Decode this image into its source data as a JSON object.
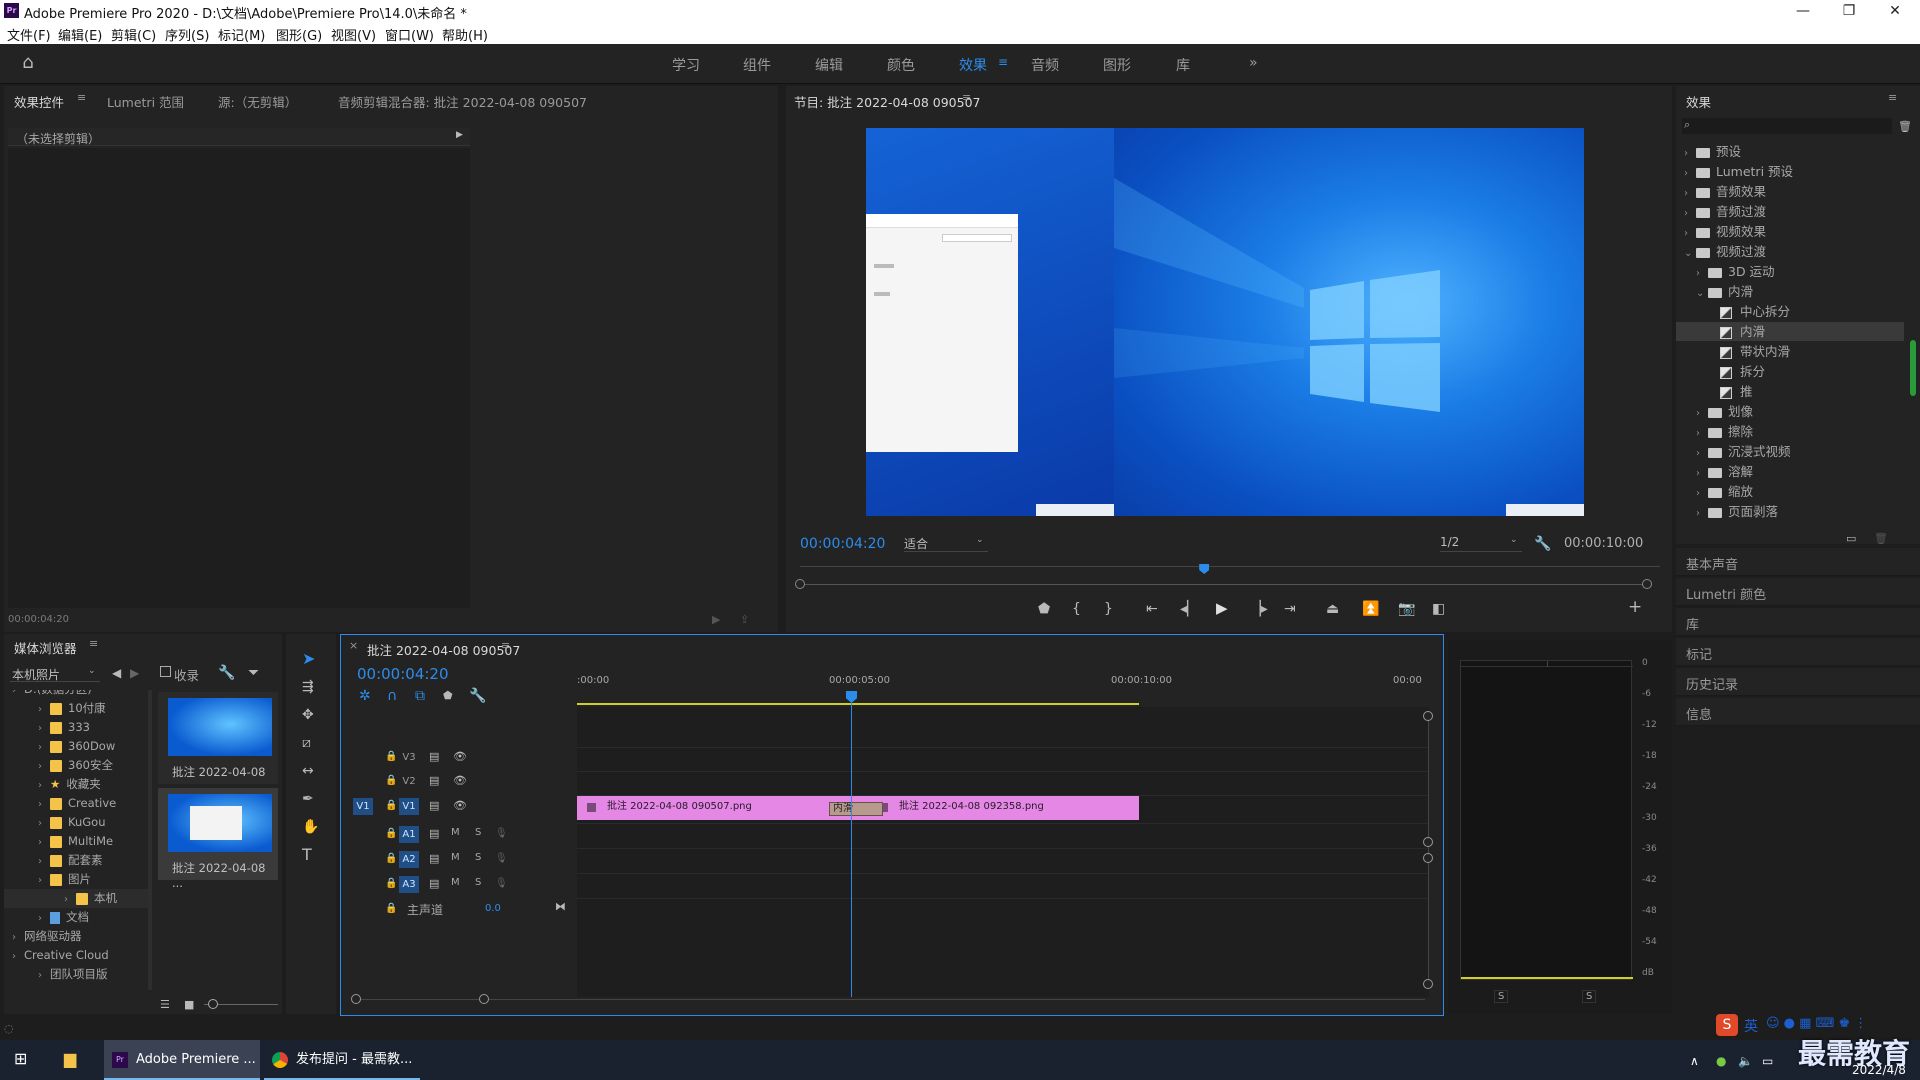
{
  "titlebar": {
    "title": "Adobe Premiere Pro 2020 - D:\\文档\\Adobe\\Premiere Pro\\14.0\\未命名 *",
    "app_icon": "Pr",
    "minimize": "—",
    "maximize": "❐",
    "close": "✕"
  },
  "menu": [
    "文件(F)",
    "编辑(E)",
    "剪辑(C)",
    "序列(S)",
    "标记(M)",
    "图形(G)",
    "视图(V)",
    "窗口(W)",
    "帮助(H)"
  ],
  "workspaces": {
    "items": [
      "学习",
      "组件",
      "编辑",
      "颜色",
      "效果",
      "音频",
      "图形",
      "库"
    ],
    "active": "效果",
    "more": "»"
  },
  "source_panel": {
    "tabs": [
      "效果控件",
      "Lumetri 范围",
      "源:（无剪辑）",
      "音频剪辑混合器: 批注 2022-04-08 090507"
    ],
    "no_clip": "（未选择剪辑）",
    "timecode": "00:00:04:20"
  },
  "program_monitor": {
    "title": "节目: 批注 2022-04-08 090507",
    "timecode": "00:00:04:20",
    "fit": "适合",
    "resolution": "1/2",
    "duration": "00:00:10:00",
    "playhead_fraction": 0.47
  },
  "effects_panel": {
    "title": "效果",
    "items": [
      {
        "label": "预设",
        "level": 0,
        "type": "folder",
        "open": false
      },
      {
        "label": "Lumetri 预设",
        "level": 0,
        "type": "folder",
        "open": false
      },
      {
        "label": "音频效果",
        "level": 0,
        "type": "folder",
        "open": false
      },
      {
        "label": "音频过渡",
        "level": 0,
        "type": "folder",
        "open": false
      },
      {
        "label": "视频效果",
        "level": 0,
        "type": "folder",
        "open": false
      },
      {
        "label": "视频过渡",
        "level": 0,
        "type": "folder",
        "open": true
      },
      {
        "label": "3D 运动",
        "level": 1,
        "type": "folder",
        "open": false
      },
      {
        "label": "内滑",
        "level": 1,
        "type": "folder",
        "open": true
      },
      {
        "label": "中心拆分",
        "level": 2,
        "type": "fx"
      },
      {
        "label": "内滑",
        "level": 2,
        "type": "fx",
        "selected": true
      },
      {
        "label": "带状内滑",
        "level": 2,
        "type": "fx"
      },
      {
        "label": "拆分",
        "level": 2,
        "type": "fx"
      },
      {
        "label": "推",
        "level": 2,
        "type": "fx"
      },
      {
        "label": "划像",
        "level": 1,
        "type": "folder",
        "open": false
      },
      {
        "label": "擦除",
        "level": 1,
        "type": "folder",
        "open": false
      },
      {
        "label": "沉浸式视频",
        "level": 1,
        "type": "folder",
        "open": false
      },
      {
        "label": "溶解",
        "level": 1,
        "type": "folder",
        "open": false
      },
      {
        "label": "缩放",
        "level": 1,
        "type": "folder",
        "open": false
      },
      {
        "label": "页面剥落",
        "level": 1,
        "type": "folder",
        "open": false
      }
    ],
    "sections": [
      "基本声音",
      "Lumetri 颜色",
      "库",
      "标记",
      "历史记录",
      "信息"
    ]
  },
  "media_browser": {
    "title": "媒体浏览器",
    "location": "本机照片",
    "ingest": "收录",
    "tree": [
      {
        "label": "D:(数据分区)",
        "level": 0
      },
      {
        "label": "10付康",
        "level": 1,
        "type": "folder"
      },
      {
        "label": "333",
        "level": 1,
        "type": "folder"
      },
      {
        "label": "360Dow",
        "level": 1,
        "type": "folder"
      },
      {
        "label": "360安全",
        "level": 1,
        "type": "folder"
      },
      {
        "label": "收藏夹",
        "level": 1,
        "type": "star"
      },
      {
        "label": "Creative",
        "level": 1,
        "type": "folder"
      },
      {
        "label": "KuGou",
        "level": 1,
        "type": "folder"
      },
      {
        "label": "MultiMe",
        "level": 1,
        "type": "folder"
      },
      {
        "label": "配套素",
        "level": 1,
        "type": "folder"
      },
      {
        "label": "图片",
        "level": 1,
        "type": "folder"
      },
      {
        "label": "本机",
        "level": 2,
        "type": "folder"
      },
      {
        "label": "文档",
        "level": 1,
        "type": "doc"
      },
      {
        "label": "网络驱动器",
        "level": 0
      },
      {
        "label": "Creative Cloud",
        "level": 0
      },
      {
        "label": "团队项目版",
        "level": 1
      }
    ],
    "thumbs": [
      "批注 2022-04-08 ...",
      "批注 2022-04-08 ..."
    ]
  },
  "timeline": {
    "title": "批注 2022-04-08 090507",
    "timecode": "00:00:04:20",
    "ruler": [
      ":00:00",
      "00:00:05:00",
      "00:00:10:00",
      "00:00"
    ],
    "video_tracks": [
      "V3",
      "V2",
      "V1"
    ],
    "audio_tracks": [
      "A1",
      "A2",
      "A3"
    ],
    "master": "主声道",
    "master_value": "0.0",
    "source_patch": "V1",
    "clips": [
      "批注 2022-04-08 090507.png",
      "批注 2022-04-08 092358.png"
    ],
    "transition": "内滑",
    "m": "M",
    "s": "S"
  },
  "audio_meter": {
    "scale": [
      "0",
      "-6",
      "-12",
      "-18",
      "-24",
      "-30",
      "-36",
      "-42",
      "-48",
      "-54",
      "dB"
    ],
    "solo": [
      "S",
      "S"
    ]
  },
  "taskbar": {
    "apps": [
      "Adobe Premiere ...",
      "发布提问 - 最需教..."
    ],
    "date": "2022/4/8",
    "watermark": "最需教育",
    "ime": "英"
  },
  "colors": {
    "accent": "#2d8ceb",
    "clip": "#e487e5",
    "playhead": "#2d8ceb"
  }
}
